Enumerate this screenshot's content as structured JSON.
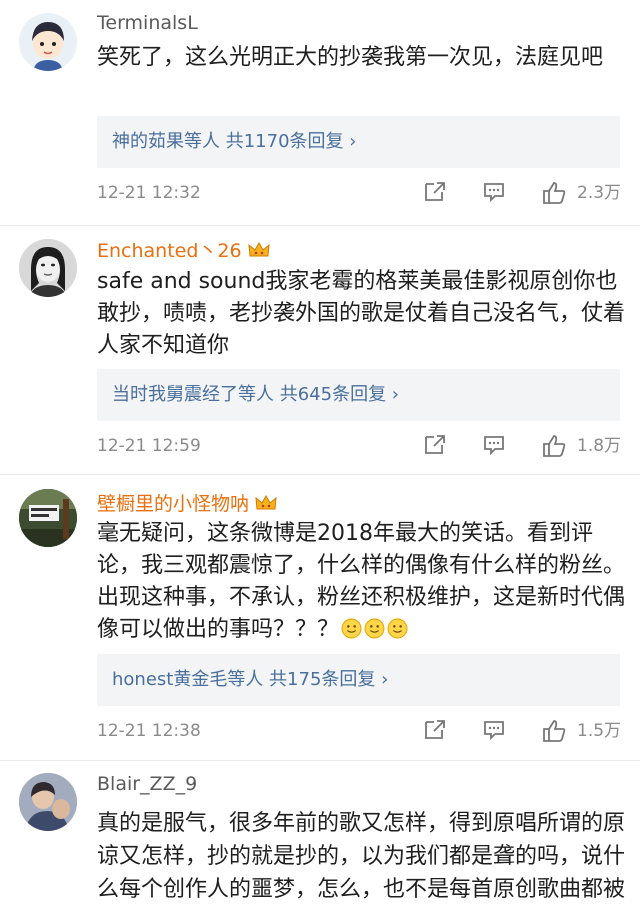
{
  "comments": [
    {
      "username": "TerminalsL",
      "text": "笑死了，这么光明正大的抄袭我第一次见，法庭见吧",
      "replies": "神的茹果等人 共1170条回复 ›",
      "time": "12-21 12:32",
      "likes": "2.3万"
    },
    {
      "username": "Enchanted丶26",
      "text": "safe and sound我家老霉的格莱美最佳影视原创你也敢抄，啧啧，老抄袭外国的歌是仗着自己没名气，仗着人家不知道你",
      "replies": "当时我舅震经了等人 共645条回复 ›",
      "time": "12-21 12:59",
      "likes": "1.8万"
    },
    {
      "username": "壁橱里的小怪物呐",
      "text": "毫无疑问，这条微博是2018年最大的笑话。看到评论，我三观都震惊了，什么样的偶像有什么样的粉丝。出现这种事，不承认，粉丝还积极维护，这是新时代偶像可以做出的事吗？？？",
      "replies": "honest黄金毛等人 共175条回复 ›",
      "time": "12-21 12:38",
      "likes": "1.5万"
    },
    {
      "username": "Blair_ZZ_9",
      "text": "真的是服气，很多年前的歌又怎样，得到原唱所谓的原谅又怎样，抄的就是抄的，以为我们都是聋的吗，说什么每个创作人的噩梦，怎么，也不是每首原创歌曲都被人盗用和别的歌曲雷同啊，别选了"
    }
  ]
}
